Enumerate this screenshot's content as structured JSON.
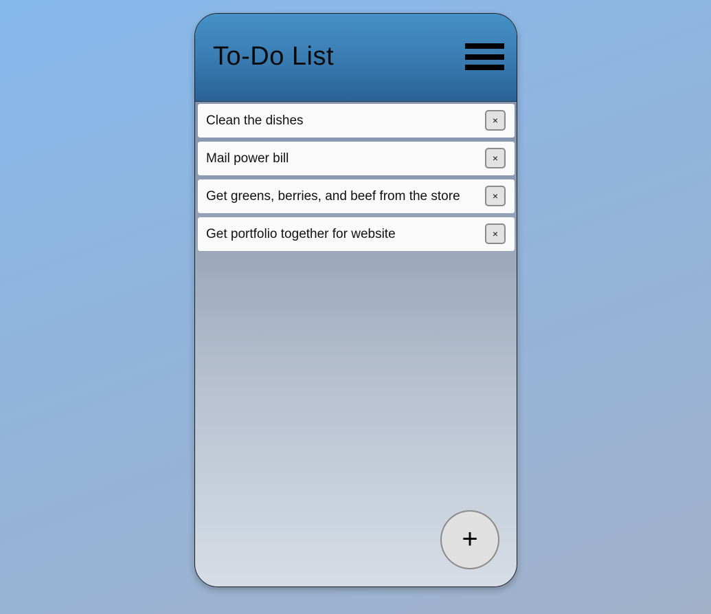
{
  "app": {
    "title": "To-Do List"
  },
  "header": {
    "menu_icon": "hamburger-menu-icon"
  },
  "tasks": [
    {
      "text": "Clean the dishes",
      "delete_label": "×"
    },
    {
      "text": "Mail power bill",
      "delete_label": "×"
    },
    {
      "text": "Get greens, berries, and beef from the store",
      "delete_label": "×"
    },
    {
      "text": "Get portfolio together for website",
      "delete_label": "×"
    }
  ],
  "add_button": {
    "label": "+"
  },
  "colors": {
    "header_top": "#4591c8",
    "header_bottom": "#2b6294",
    "task_background": "#fafafa",
    "button_background": "#e2e2e2"
  }
}
